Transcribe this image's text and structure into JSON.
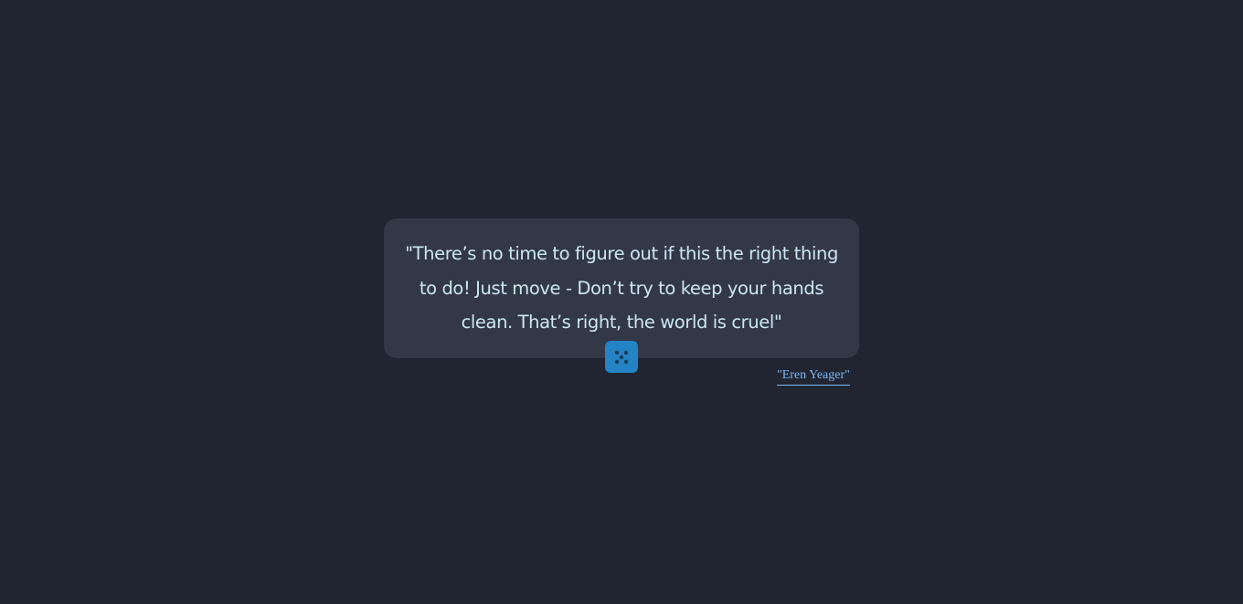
{
  "quote": {
    "text": "\"There’s no time to figure out if this the right thing to do! Just move - Don’t try to keep your hands clean. That’s right, the world is cruel\"",
    "author": "\"Eren Yeager\""
  },
  "dice_button": {
    "icon": "dice-five-icon"
  },
  "colors": {
    "background": "#202531",
    "card": "#323846",
    "quote_text": "#cde6f4",
    "accent": "#2383c5",
    "author_link": "#7db7f0"
  }
}
